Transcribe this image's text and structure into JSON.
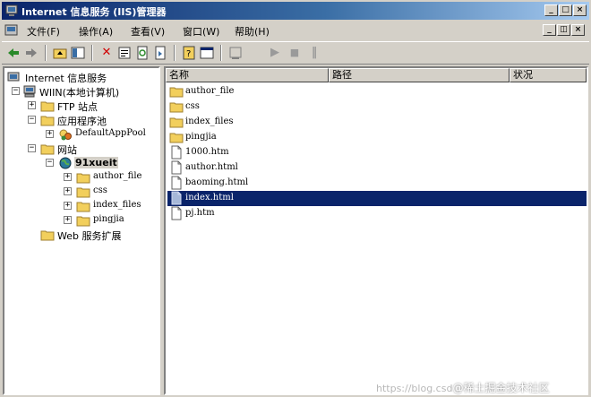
{
  "window": {
    "title": "Internet 信息服务 (IIS)管理器",
    "controls": {
      "minimize": "_",
      "maximize": "□",
      "close": "×"
    }
  },
  "menu": {
    "items": [
      "文件(F)",
      "操作(A)",
      "查看(V)",
      "窗口(W)",
      "帮助(H)"
    ],
    "child_controls": {
      "minimize": "_",
      "restore": "◫",
      "close": "×"
    }
  },
  "toolbar": {
    "icons": [
      "back-icon",
      "forward-icon",
      "up-folder-icon",
      "show-tree-icon",
      "delete-icon",
      "properties-icon",
      "refresh-icon",
      "export-icon",
      "help-icon",
      "console-icon",
      "start-icon",
      "stop-icon",
      "pause-icon"
    ]
  },
  "tree": {
    "nodes": [
      {
        "label": "Internet 信息服务",
        "icon": "iis-icon",
        "expander": ""
      },
      {
        "label": "WIIN(本地计算机)",
        "icon": "computer-icon",
        "expander": "−"
      },
      {
        "label": "FTP 站点",
        "icon": "folder-icon",
        "expander": "+"
      },
      {
        "label": "应用程序池",
        "icon": "folder-icon",
        "expander": "−"
      },
      {
        "label": "DefaultAppPool",
        "icon": "app-pool-icon",
        "expander": "+"
      },
      {
        "label": "网站",
        "icon": "folder-icon",
        "expander": "−"
      },
      {
        "label": "91xueit",
        "icon": "globe-icon",
        "expander": "−"
      },
      {
        "label": "author_file",
        "icon": "folder-icon",
        "expander": "+"
      },
      {
        "label": "css",
        "icon": "folder-icon",
        "expander": "+"
      },
      {
        "label": "index_files",
        "icon": "folder-icon",
        "expander": "+"
      },
      {
        "label": "pingjia",
        "icon": "folder-icon",
        "expander": "+"
      },
      {
        "label": "Web 服务扩展",
        "icon": "folder-icon",
        "expander": ""
      }
    ]
  },
  "list": {
    "columns": [
      "名称",
      "路径",
      "状况"
    ],
    "rows": [
      {
        "name": "author_file",
        "icon": "folder-icon",
        "selected": false
      },
      {
        "name": "css",
        "icon": "folder-icon",
        "selected": false
      },
      {
        "name": "index_files",
        "icon": "folder-icon",
        "selected": false
      },
      {
        "name": "pingjia",
        "icon": "folder-icon",
        "selected": false
      },
      {
        "name": "1000.htm",
        "icon": "file-icon",
        "selected": false
      },
      {
        "name": "author.html",
        "icon": "file-icon",
        "selected": false
      },
      {
        "name": "baoming.html",
        "icon": "file-icon",
        "selected": false
      },
      {
        "name": "index.html",
        "icon": "file-icon",
        "selected": true
      },
      {
        "name": "pj.htm",
        "icon": "file-icon",
        "selected": false
      }
    ]
  },
  "watermark": {
    "url": "https://blog.csd",
    "text": "@稀土掘金技术社区"
  },
  "colors": {
    "title_start": "#0a246a",
    "title_end": "#a6caf0",
    "selection": "#0a246a",
    "folder": "#f2cf5c",
    "chrome": "#d4d0c8"
  }
}
